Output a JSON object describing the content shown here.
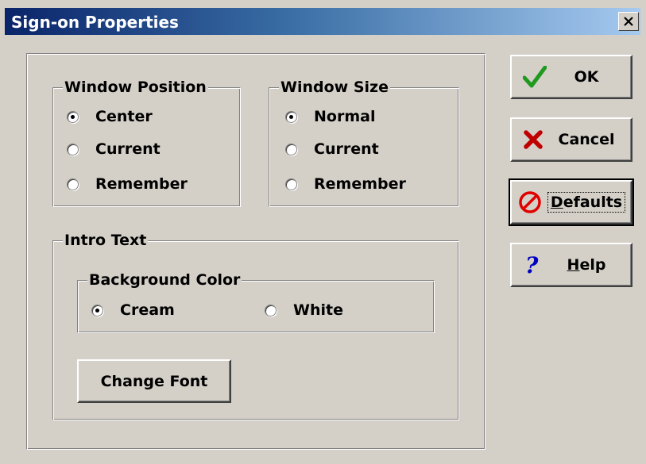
{
  "window": {
    "title": "Sign-on Properties",
    "close_label": "close"
  },
  "window_position": {
    "legend": "Window Position",
    "options": [
      "Center",
      "Current",
      "Remember"
    ],
    "selected": "Center"
  },
  "window_size": {
    "legend": "Window Size",
    "options": [
      "Normal",
      "Current",
      "Remember"
    ],
    "selected": "Normal"
  },
  "intro_text": {
    "legend": "Intro Text",
    "background_color": {
      "legend": "Background Color",
      "options": [
        "Cream",
        "White"
      ],
      "selected": "Cream"
    },
    "change_font_label": "Change Font"
  },
  "buttons": {
    "ok": {
      "label": "OK",
      "icon": "checkmark-icon"
    },
    "cancel": {
      "label": "Cancel",
      "icon": "x-icon"
    },
    "defaults": {
      "label": "Defaults",
      "mnemonic": "D",
      "rest": "efaults",
      "icon": "prohibited-icon"
    },
    "help": {
      "label": "Help",
      "mnemonic": "H",
      "rest": "elp",
      "icon": "question-icon"
    }
  },
  "colors": {
    "title_gradient_start": "#0a246a",
    "title_gradient_end": "#a6caf0",
    "face": "#d4d0c8",
    "ok_check": "#1f9a1f",
    "cancel_x": "#c00000",
    "defaults_icon": "#e00000",
    "help_icon": "#0000c0"
  }
}
